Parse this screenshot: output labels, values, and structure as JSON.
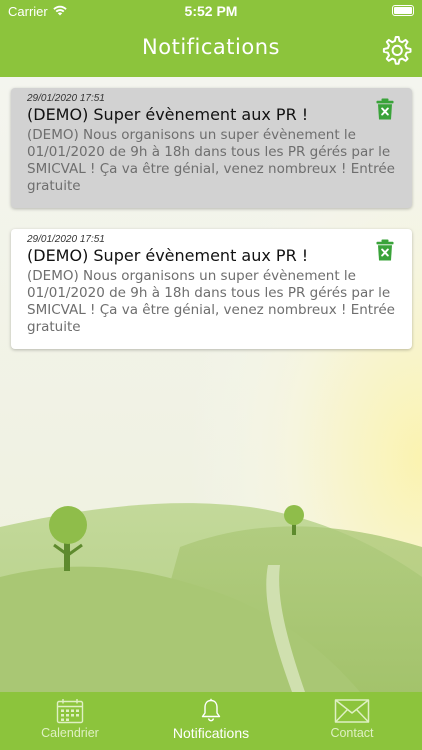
{
  "status": {
    "carrier": "Carrier",
    "time": "5:52 PM"
  },
  "nav": {
    "title": "Notifications",
    "settings_icon": "gear-icon"
  },
  "colors": {
    "brand_green": "#8cc43c",
    "trash_green": "#3aa33a",
    "read_card_bg": "#d2d2d2",
    "unread_card_bg": "#ffffff"
  },
  "notifications": [
    {
      "date": "29/01/2020 17:51",
      "title": "(DEMO) Super évènement aux PR !",
      "body": "(DEMO) Nous organisons un super évènement le 01/01/2020 de 9h à 18h dans tous les PR gérés par le SMICVAL ! Ça va être génial, venez nombreux ! Entrée gratuite",
      "read": true,
      "delete_icon": "trash-icon"
    },
    {
      "date": "29/01/2020 17:51",
      "title": "(DEMO) Super évènement aux PR !",
      "body": "(DEMO) Nous organisons un super évènement le 01/01/2020 de 9h à 18h dans tous les PR gérés par le SMICVAL ! Ça va être génial, venez nombreux ! Entrée gratuite",
      "read": false,
      "delete_icon": "trash-icon"
    }
  ],
  "tabs": [
    {
      "label": "Calendrier",
      "icon": "calendar-icon",
      "active": false
    },
    {
      "label": "Notifications",
      "icon": "bell-icon",
      "active": true
    },
    {
      "label": "Contact",
      "icon": "envelope-icon",
      "active": false
    }
  ]
}
